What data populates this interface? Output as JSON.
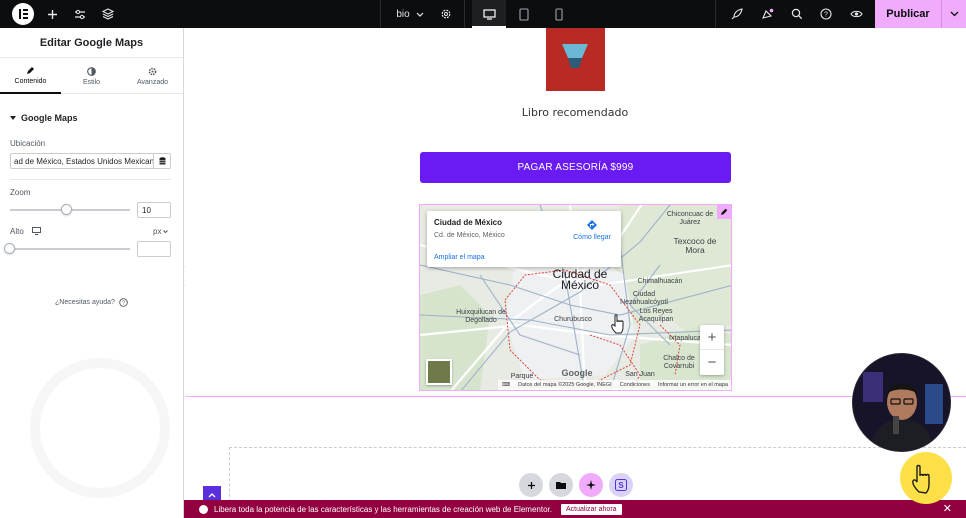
{
  "topbar": {
    "page_name": "bio",
    "publish_label": "Publicar",
    "icons": [
      "elementor-logo-icon",
      "plus-icon",
      "sliders-icon",
      "layers-icon",
      "gear-icon",
      "desktop-icon",
      "tablet-icon",
      "mobile-icon",
      "rocket-icon",
      "notifications-icon",
      "search-icon",
      "help-icon",
      "eye-icon",
      "chevron-down-icon"
    ]
  },
  "sidebar": {
    "title": "Editar Google Maps",
    "tabs": [
      {
        "label": "Contenido",
        "active": true
      },
      {
        "label": "Estilo",
        "active": false
      },
      {
        "label": "Avanzado",
        "active": false
      }
    ],
    "section_title": "Google Maps",
    "location_label": "Ubicación",
    "location_value": "ad de México, Estados Unidos Mexicanos",
    "zoom_label": "Zoom",
    "zoom_value": "10",
    "zoom_fraction": 0.47,
    "height_label": "Alto",
    "height_unit": "px",
    "height_value": "",
    "help_text": "¿Necesitas ayuda?"
  },
  "canvas": {
    "book_caption": "Libro recomendado",
    "cta_label": "PAGAR ASESORÍA $999",
    "map": {
      "place_name": "Ciudad de México",
      "place_address": "Cd. de México, México",
      "directions_label": "Cómo llegar",
      "enlarge_label": "Ampliar el mapa",
      "labels": {
        "chiconcuac": "Chiconcuac de Juárez",
        "texcoco": "Texcoco de Mora",
        "cdmx": "Ciudad de México",
        "chimalhuacan": "Chimalhuacán",
        "nezahualcoyotl": "Ciudad Nezahualcóyotl",
        "huixquilucan": "Huixquilucan de Degollado",
        "churubusco": "Churubusco",
        "los_reyes": "Los Reyes Acaquilpan",
        "ixtapaluca": "Ixtapaluca",
        "chalco": "Chalco de Covarrubi",
        "parque": "Parque",
        "san_juan": "San Juan",
        "google": "Google"
      },
      "attribution": {
        "keyboard": "⌨",
        "data": "Datos del mapa ©2025 Google, INEGI",
        "terms": "Condiciones",
        "report": "Informar un error en el mapa"
      },
      "zoom_in": "+",
      "zoom_out": "−"
    }
  },
  "banner": {
    "text": "Libera toda la potencia de las características y las herramientas de creación web de Elementor.",
    "button_label": "Actualizar ahora",
    "close": "✕"
  },
  "colors": {
    "topbar_bg": "#0c0d0e",
    "accent_pink": "#f0abfc",
    "cta_purple": "#6a1af3",
    "banner_bg": "#93003f",
    "link_blue": "#1a73e8"
  }
}
